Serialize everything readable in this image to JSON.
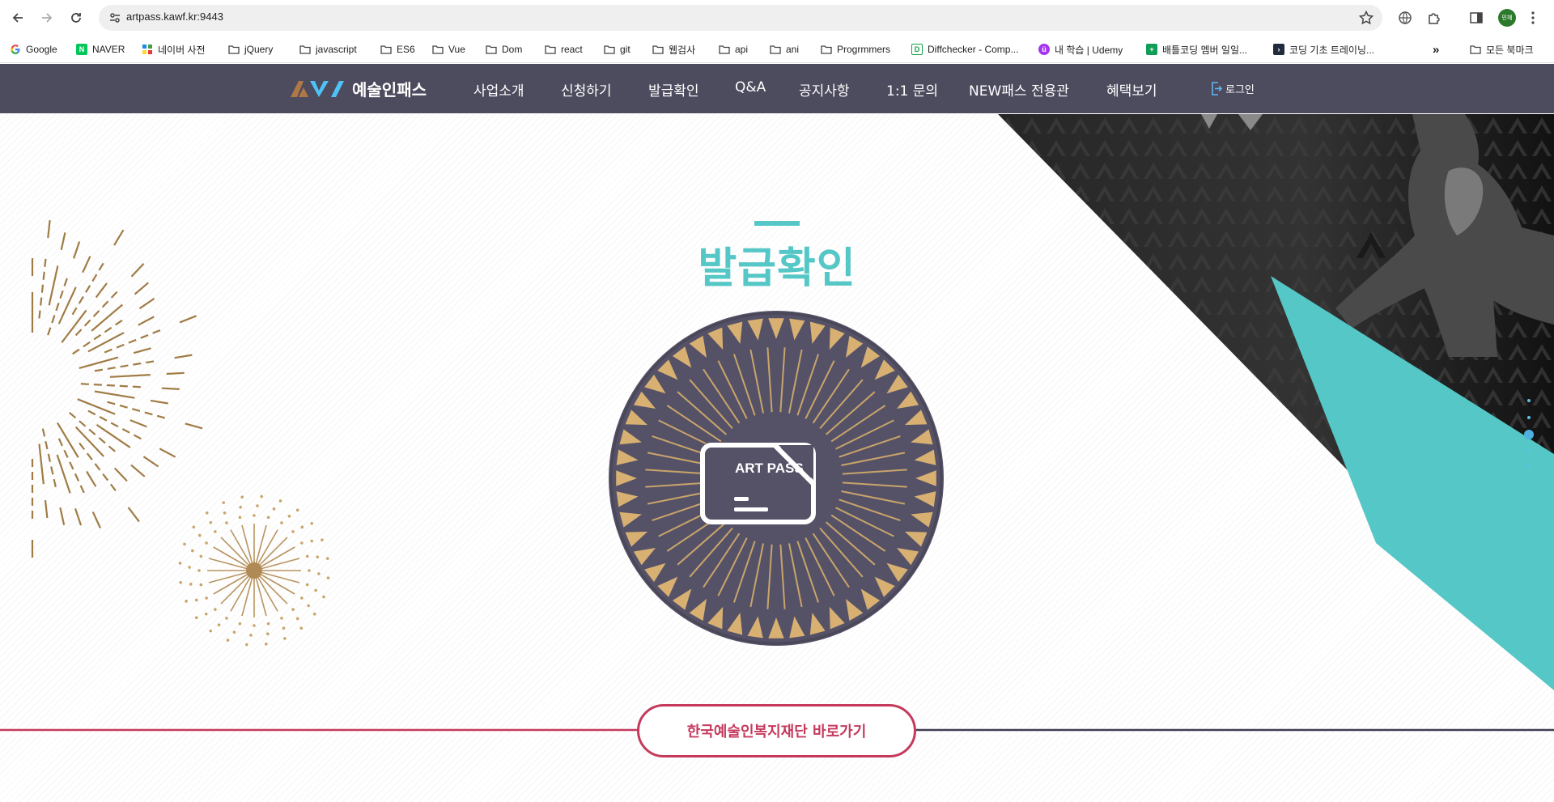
{
  "browser": {
    "url": "artpass.kawf.kr:9443",
    "profile_label": "민혜",
    "bookmarks": [
      {
        "label": "Google",
        "icon": "google-icon"
      },
      {
        "label": "NAVER",
        "icon": "naver-icon"
      },
      {
        "label": "네이버 사전",
        "icon": "naver-dictionary-icon"
      },
      {
        "label": "jQuery",
        "icon": "folder-icon"
      },
      {
        "label": "javascript",
        "icon": "folder-icon"
      },
      {
        "label": "ES6",
        "icon": "folder-icon"
      },
      {
        "label": "Vue",
        "icon": "folder-icon"
      },
      {
        "label": "Dom",
        "icon": "folder-icon"
      },
      {
        "label": "react",
        "icon": "folder-icon"
      },
      {
        "label": "git",
        "icon": "folder-icon"
      },
      {
        "label": "웹검사",
        "icon": "folder-icon"
      },
      {
        "label": "api",
        "icon": "folder-icon"
      },
      {
        "label": "ani",
        "icon": "folder-icon"
      },
      {
        "label": "Progrmmers",
        "icon": "folder-icon"
      },
      {
        "label": "Diffchecker - Comp...",
        "icon": "diffchecker-icon"
      },
      {
        "label": "내 학습 | Udemy",
        "icon": "udemy-icon"
      },
      {
        "label": "배틀코딩 멤버 일일...",
        "icon": "sheets-icon"
      },
      {
        "label": "코딩 기초 트레이닝...",
        "icon": "programmers-icon"
      }
    ],
    "all_bookmarks_label": "모든 북마크",
    "more_label": "»"
  },
  "header": {
    "logo_text": "예술인패스",
    "nav": [
      "사업소개",
      "신청하기",
      "발급확인",
      "Q&A",
      "공지사항",
      "1:1 문의",
      "NEW패스 전용관",
      "혜택보기"
    ],
    "login_label": "로그인"
  },
  "main": {
    "title": "발급확인",
    "card_label": "ART PASS",
    "link_button": "한국예술인복지재단 바로가기"
  },
  "colors": {
    "header_bg": "#4d4b5e",
    "accent_teal": "#55c7c6",
    "gold": "#c9a46a",
    "emblem_bg": "#555268",
    "link_red": "#c53a5c"
  }
}
